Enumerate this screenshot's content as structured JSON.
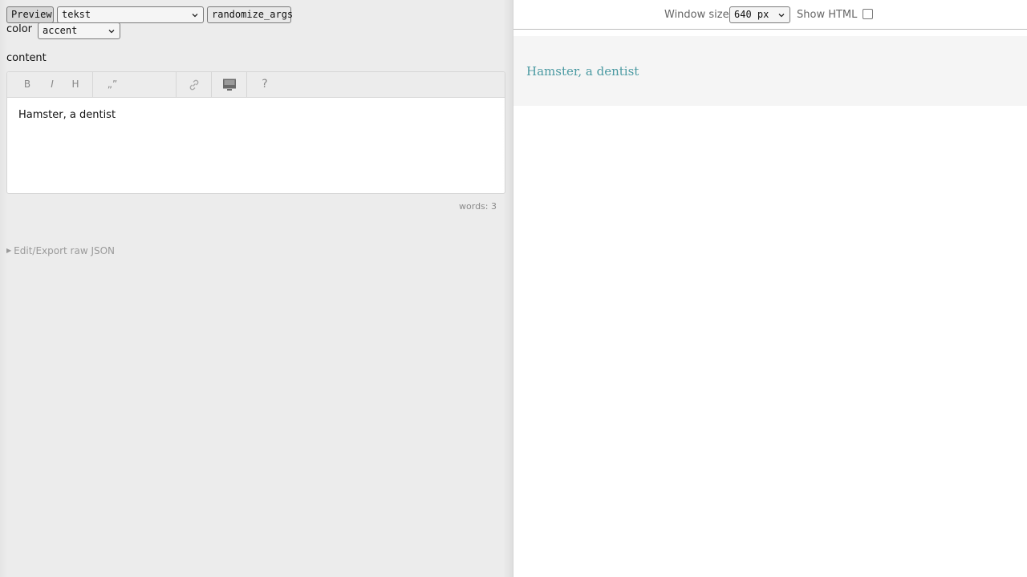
{
  "toolbar": {
    "preview_label": "Preview",
    "component_value": "tekst",
    "randomize_label": "randomize_args"
  },
  "props": {
    "color_label": "color",
    "color_value": "accent",
    "content_label": "content"
  },
  "editor": {
    "bold_label": "B",
    "italic_label": "I",
    "heading_label": "H",
    "quote_label": "„”",
    "help_label": "?",
    "text": "Hamster, a dentist",
    "word_count": "words: 3"
  },
  "raw_json": {
    "label": "Edit/Export raw JSON"
  },
  "preview": {
    "window_size_label": "Window size",
    "window_size_value": "640 px",
    "show_html_label": "Show HTML",
    "show_html_checked": false,
    "rendered_text": "Hamster, a dentist"
  },
  "colors": {
    "accent": "#4b9aa2",
    "panel_bg": "#ececec",
    "preview_bg": "#f5f5f5"
  },
  "icons": {
    "link": "link-icon",
    "image": "image-icon",
    "help": "help-icon",
    "chevron": "chevron-down-icon"
  }
}
